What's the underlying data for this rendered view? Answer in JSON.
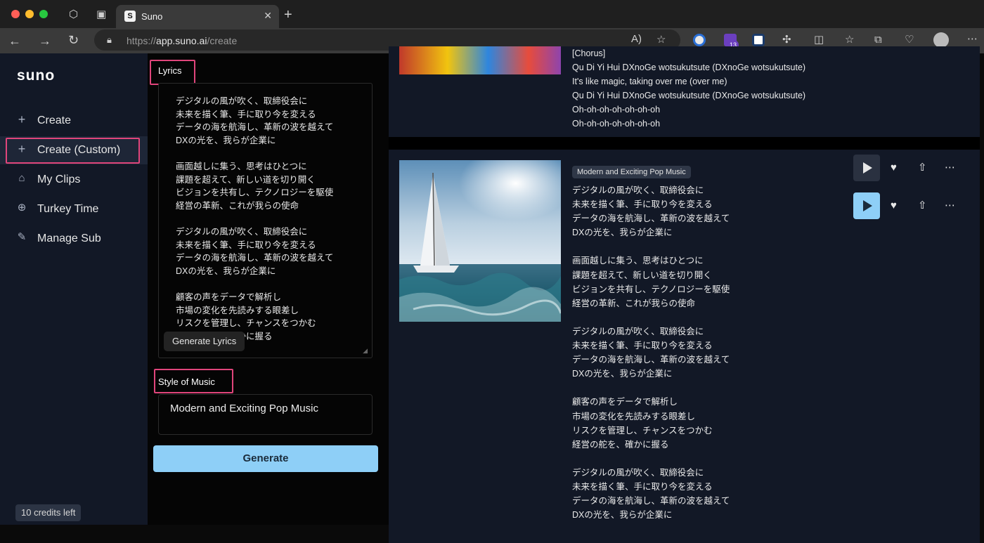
{
  "browser": {
    "tab_title": "Suno",
    "tab_favicon": "S",
    "url_scheme": "https://",
    "url_host": "app.suno.ai",
    "url_path": "/create",
    "extension_badge": "13"
  },
  "sidebar": {
    "logo": "suno",
    "items": [
      {
        "label": "Create",
        "icon": "plus-icon"
      },
      {
        "label": "Create (Custom)",
        "icon": "plus-icon"
      },
      {
        "label": "My Clips",
        "icon": "home-icon"
      },
      {
        "label": "Turkey Time",
        "icon": "globe-icon"
      },
      {
        "label": "Manage Sub",
        "icon": "edit-icon"
      }
    ],
    "credits": "10 credits left"
  },
  "form": {
    "lyrics_label": "Lyrics",
    "lyrics_value": "デジタルの風が吹く、取締役会に\n未来を描く筆、手に取り今を変える\nデータの海を航海し、革新の波を越えて\nDXの光を、我らが企業に\n\n画面越しに集う、思考はひとつに\n課題を超えて、新しい道を切り開く\nビジョンを共有し、テクノロジーを駆使\n経営の革新、これが我らの使命\n\nデジタルの風が吹く、取締役会に\n未来を描く筆、手に取り今を変える\nデータの海を航海し、革新の波を越えて\nDXの光を、我らが企業に\n\n顧客の声をデータで解析し\n市場の変化を先読みする眼差し\nリスクを管理し、チャンスをつかむ\n経営の舵を、確かに握る",
    "generate_lyrics_label": "Generate Lyrics",
    "style_label": "Style of Music",
    "style_value": "Modern and Exciting Pop Music",
    "generate_label": "Generate"
  },
  "songs": [
    {
      "lyrics": "[Chorus]\nQu Di Yi Hui DXnoGe wotsukutsute (DXnoGe wotsukutsute)\nIt's like magic, taking over me (over me)\nQu Di Yi Hui DXnoGe wotsukutsute (DXnoGe wotsukutsute)\nOh-oh-oh-oh-oh-oh-oh\nOh-oh-oh-oh-oh-oh-oh"
    },
    {
      "style_tag": "Modern and Exciting Pop Music",
      "lyrics": "デジタルの風が吹く、取締役会に\n未来を描く筆、手に取り今を変える\nデータの海を航海し、革新の波を越えて\nDXの光を、我らが企業に\n\n画面越しに集う、思考はひとつに\n課題を超えて、新しい道を切り開く\nビジョンを共有し、テクノロジーを駆使\n経営の革新、これが我らの使命\n\nデジタルの風が吹く、取締役会に\n未来を描く筆、手に取り今を変える\nデータの海を航海し、革新の波を越えて\nDXの光を、我らが企業に\n\n顧客の声をデータで解析し\n市場の変化を先読みする眼差し\nリスクを管理し、チャンスをつかむ\n経営の舵を、確かに握る\n\nデジタルの風が吹く、取締役会に\n未来を描く筆、手に取り今を変える\nデータの海を航海し、革新の波を越えて\nDXの光を、我らが企業に"
    }
  ],
  "colors": {
    "accent": "#8ecff7",
    "highlight": "#e0457b",
    "sidebar_bg": "#121826"
  }
}
